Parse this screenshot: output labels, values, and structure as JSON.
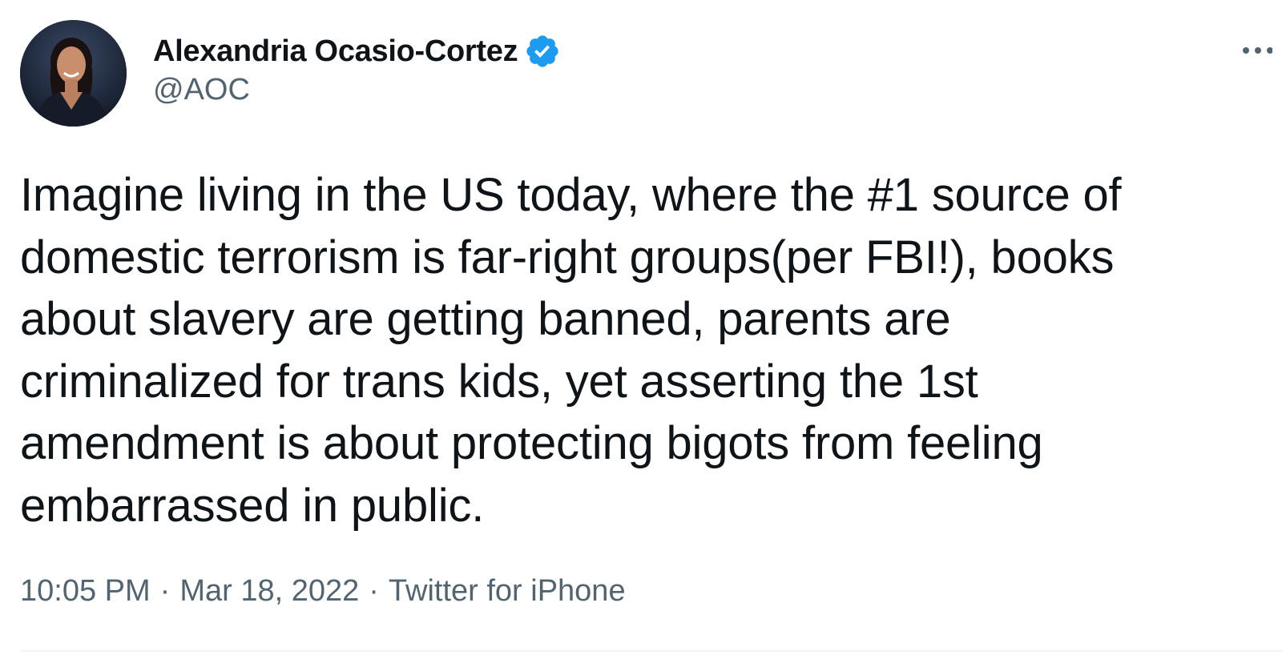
{
  "tweet": {
    "author": {
      "display_name": "Alexandria Ocasio-Cortez",
      "handle": "@AOC",
      "verified_icon": "verified-badge-icon",
      "avatar_icon": "profile-photo"
    },
    "text_lines": [
      "Imagine living in the US today, where the #1 source of",
      "domestic terrorism is far-right groups(per FBI!), books",
      "about slavery are getting banned, parents are",
      "criminalized for trans kids, yet asserting the 1st",
      "amendment is about protecting bigots from feeling",
      "embarrassed in public."
    ],
    "time": "10:05 PM",
    "date": "Mar 18, 2022",
    "source": "Twitter for iPhone",
    "separator": "·",
    "more_icon": "more-options-icon"
  },
  "colors": {
    "text_primary": "#0f1419",
    "text_secondary": "#536471",
    "verified_blue": "#1d9bf0",
    "divider": "#eff3f4"
  }
}
